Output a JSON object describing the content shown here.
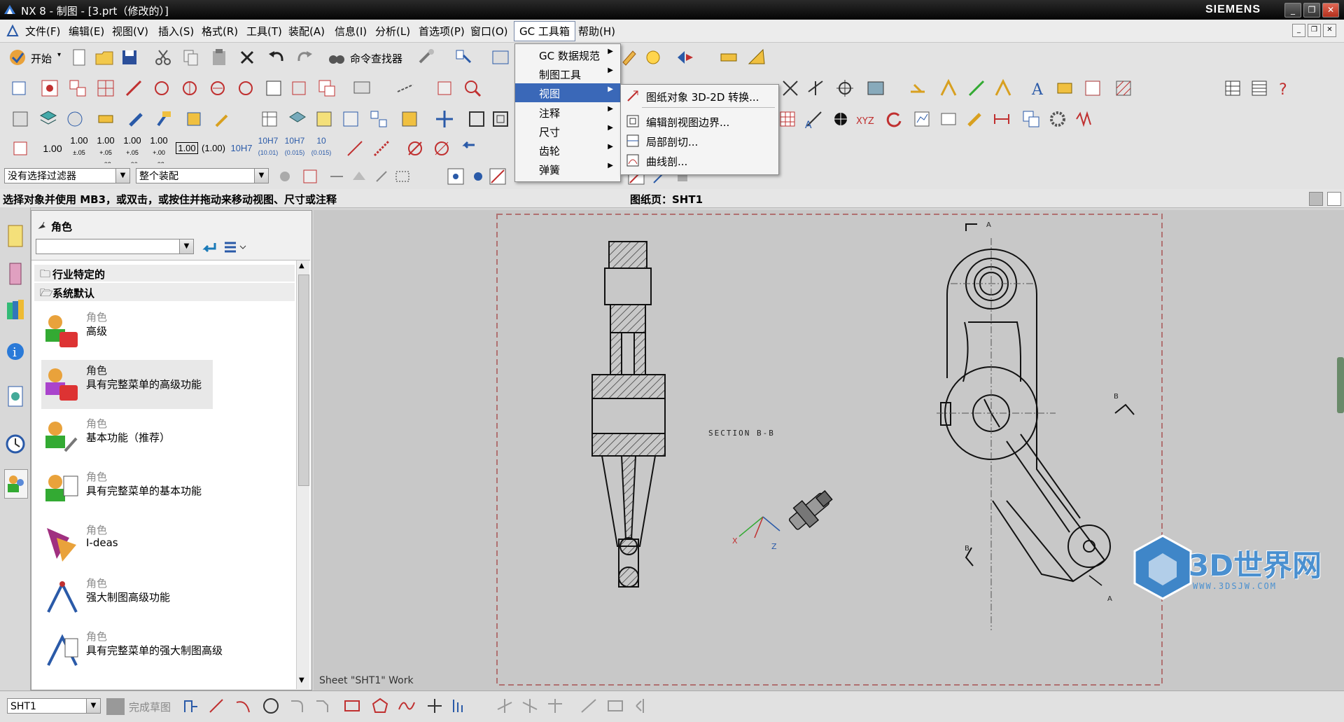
{
  "window": {
    "title": "NX 8 - 制图 - [3.prt（修改的）]",
    "brand": "SIEMENS"
  },
  "menubar": {
    "items": [
      "文件(F)",
      "编辑(E)",
      "视图(V)",
      "插入(S)",
      "格式(R)",
      "工具(T)",
      "装配(A)",
      "信息(I)",
      "分析(L)",
      "首选项(P)",
      "窗口(O)",
      "GC 工具箱",
      "帮助(H)"
    ]
  },
  "toolbar1": {
    "start_label": "开始",
    "cmd_finder_label": "命令查找器"
  },
  "dim_buttons": [
    "1.00",
    "1.00",
    "1.00",
    "1.00",
    "1.00",
    "1.00",
    "(1.00)",
    "10H7",
    "10H7",
    "10H7",
    "10"
  ],
  "selection": {
    "filter_value": "没有选择过滤器",
    "scope_value": "整个装配"
  },
  "status": {
    "prompt": "选择对象并使用 MB3，或双击，或按住并拖动来移动视图、尺寸或注释",
    "sheet": "图纸页：SHT1"
  },
  "role_panel": {
    "title": "角色",
    "folders": [
      "行业特定的",
      "系统默认"
    ],
    "roles": [
      {
        "cat": "角色",
        "name": "高级"
      },
      {
        "cat": "角色",
        "name": "具有完整菜单的高级功能"
      },
      {
        "cat": "角色",
        "name": "基本功能（推荐）"
      },
      {
        "cat": "角色",
        "name": "具有完整菜单的基本功能"
      },
      {
        "cat": "角色",
        "name": "I-deas"
      },
      {
        "cat": "角色",
        "name": "强大制图高级功能"
      },
      {
        "cat": "角色",
        "name": "具有完整菜单的强大制图高级"
      }
    ]
  },
  "gc_menu": {
    "items": [
      "GC 数据规范",
      "制图工具",
      "视图",
      "注释",
      "尺寸",
      "齿轮",
      "弹簧"
    ],
    "highlighted": "视图"
  },
  "view_submenu": {
    "items": [
      "图纸对象 3D-2D 转换...",
      "编辑剖视图边界...",
      "局部剖切...",
      "曲线剖..."
    ]
  },
  "drawing": {
    "section_label": "SECTION B-B",
    "sheet_label": "Sheet \"SHT1\" Work",
    "marks": {
      "a_top": "A",
      "a_bottom": "A",
      "b_right": "B",
      "b_left": "B"
    },
    "axes": {
      "x": "X",
      "z": "Z"
    }
  },
  "bottom": {
    "sheet_value": "SHT1",
    "finish_sketch": "完成草图"
  },
  "watermark": {
    "text": "3D世界网",
    "url": "WWW.3DSJW.COM"
  },
  "colors": {
    "menu_highlight": "#3a68b8",
    "canvas_bg": "#c8c8c8",
    "border_dash": "#b07070"
  }
}
